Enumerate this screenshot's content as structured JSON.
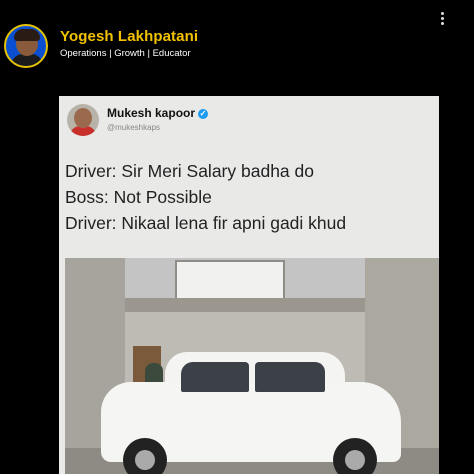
{
  "profile": {
    "name": "Yogesh Lakhpatani",
    "tagline": "Operations | Growth | Educator",
    "accent_color": "#f2c200",
    "menu_icon": "more-vertical-icon"
  },
  "post": {
    "author_name": "Mukesh kapoor",
    "author_handle": "@mukeshkaps",
    "verified_icon": "verified-badge-icon",
    "lines": [
      "Driver: Sir Meri Salary badha do",
      "Boss: Not Possible",
      "Driver: Nikaal lena fir apni gadi khud"
    ]
  }
}
